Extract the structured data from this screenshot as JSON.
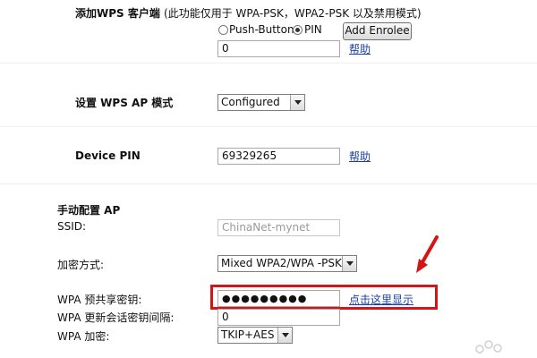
{
  "wps": {
    "add_client_label": "添加WPS 客户端",
    "add_client_note": "(此功能仅用于 WPA-PSK，WPA2-PSK 以及禁用模式)",
    "radio_push_label": "Push-Button",
    "radio_pin_label": "PIN",
    "radio_selected": "PIN",
    "add_enrolee_label": "Add Enrolee",
    "pin_input_value": "0",
    "help_label": "帮助",
    "ap_mode_label": "设置 WPS AP 模式",
    "ap_mode_value": "Configured",
    "device_pin_label": "Device PIN",
    "device_pin_value": "69329265",
    "device_pin_help_label": "帮助"
  },
  "manual": {
    "section_title": "手动配置 AP",
    "ssid_label": "SSID:",
    "ssid_value": "ChinaNet-mynet",
    "encryption_label": "加密方式:",
    "encryption_value": "Mixed WPA2/WPA -PSK",
    "psk_label": "WPA 预共享密钥:",
    "psk_value": "●●●●●●●●●",
    "show_link_label": "点击这里显示",
    "rekey_label": "WPA 更新会话密钥间隔:",
    "rekey_value": "0",
    "wpa_cipher_label": "WPA 加密:",
    "wpa_cipher_value": "TKIP+AES"
  },
  "colors": {
    "highlight": "#d31515",
    "link": "#1a3fa8"
  }
}
